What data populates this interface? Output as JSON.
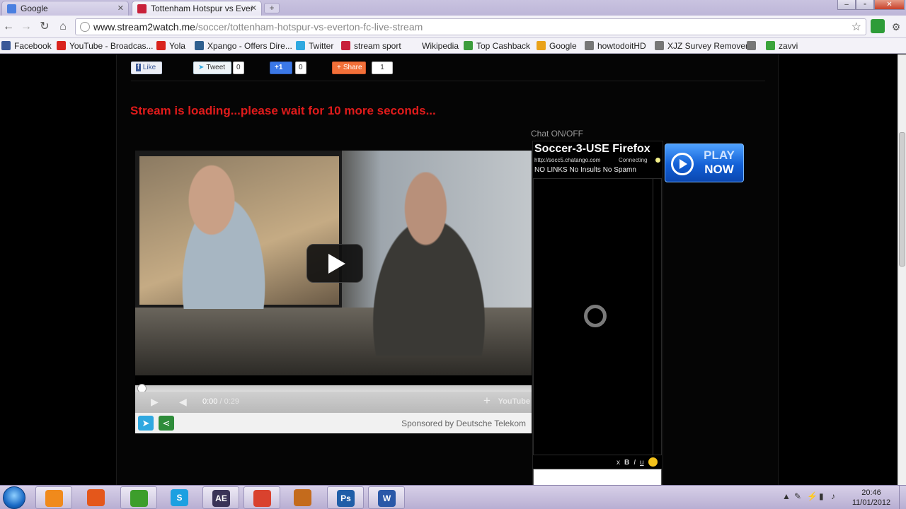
{
  "browser": {
    "tabs": [
      {
        "title": "Google",
        "active": false
      },
      {
        "title": "Tottenham Hotspur vs Ever",
        "active": true
      }
    ],
    "new_tab": "+",
    "window_controls": {
      "minimize": "–",
      "maximize": "▫",
      "close": "✕"
    },
    "url_host": "www.stream2watch.me",
    "url_path": "/soccer/tottenham-hotspur-vs-everton-fc-live-stream",
    "bookmarks": [
      {
        "label": "Facebook",
        "icon": "facebook-icon",
        "color": "#3b5998"
      },
      {
        "label": "YouTube - Broadcas...",
        "icon": "youtube-icon",
        "color": "#d9231d"
      },
      {
        "label": "Yola",
        "icon": "yola-icon",
        "color": "#d9231d"
      },
      {
        "label": "Xpango - Offers Dire...",
        "icon": "xpango-icon",
        "color": "#2f5f8f"
      },
      {
        "label": "Twitter",
        "icon": "twitter-icon",
        "color": "#2fa8e0"
      },
      {
        "label": "stream sport",
        "icon": "stream-sport-icon",
        "color": "#c8213a"
      },
      {
        "label": "Wikipedia",
        "icon": "",
        "color": ""
      },
      {
        "label": "Top Cashback",
        "icon": "cashback-icon",
        "color": "#3c9c3c"
      },
      {
        "label": "Google",
        "icon": "google-icon",
        "color": "#e9a21a"
      },
      {
        "label": "howtodoitHD",
        "icon": "globe-icon",
        "color": "#777777"
      },
      {
        "label": "XJZ Survey Remover",
        "icon": "globe-icon",
        "color": "#777777"
      },
      {
        "label": "",
        "icon": "globe-icon",
        "color": "#777777"
      },
      {
        "label": "zavvi",
        "icon": "zavvi-icon",
        "color": "#3ba43b"
      }
    ]
  },
  "page": {
    "social": {
      "like": "Like",
      "tweet": "Tweet",
      "tweet_count": "0",
      "plusone": "+1",
      "plusone_count": "0",
      "share": "Share",
      "share_count": "1"
    },
    "loading_message": "Stream is loading...please wait for 10 more seconds...",
    "video": {
      "current_time": "0:00",
      "separator": " / ",
      "duration": "0:29",
      "brand": "YouTube",
      "sponsor": "Sponsored by Deutsche Telekom"
    },
    "chat": {
      "toggle": "Chat ON/OFF",
      "title": "Soccer-3-USE Firefox",
      "url": "http://socc5.chatango.com",
      "status": "Connecting",
      "rules": "NO LINKS No Insults No Spamn",
      "format_buttons": [
        "x",
        "B",
        "I",
        "u"
      ]
    },
    "play_now": {
      "line1": "PLAY",
      "line2": "NOW"
    }
  },
  "taskbar": {
    "apps": [
      {
        "name": "media-player",
        "label": "",
        "color": "#f08a1c",
        "active": true
      },
      {
        "name": "firefox",
        "label": "",
        "color": "#e4571b",
        "active": false
      },
      {
        "name": "utorrent",
        "label": "",
        "color": "#3d9e2c",
        "active": true
      },
      {
        "name": "skype",
        "label": "S",
        "color": "#1ba0e1",
        "active": false
      },
      {
        "name": "after-effects",
        "label": "AE",
        "color": "#3a3357",
        "active": true
      },
      {
        "name": "chrome",
        "label": "",
        "color": "#d9422e",
        "active": true
      },
      {
        "name": "winamp",
        "label": "",
        "color": "#c46b1c",
        "active": false
      },
      {
        "name": "photoshop",
        "label": "Ps",
        "color": "#1f5ea8",
        "active": true
      },
      {
        "name": "word",
        "label": "W",
        "color": "#2a58a8",
        "active": true
      }
    ],
    "time": "20:46",
    "date": "11/01/2012"
  }
}
